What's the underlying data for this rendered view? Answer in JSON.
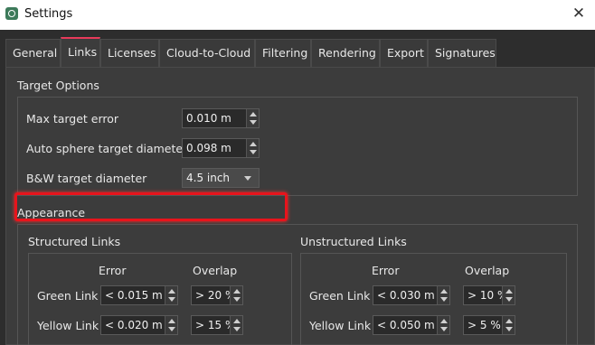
{
  "window": {
    "title": "Settings",
    "close_glyph": "✕",
    "icon": "app-icon"
  },
  "tabs": [
    {
      "label": "General"
    },
    {
      "label": "Links",
      "active": true
    },
    {
      "label": "Licenses"
    },
    {
      "label": "Cloud-to-Cloud"
    },
    {
      "label": "Filtering"
    },
    {
      "label": "Rendering"
    },
    {
      "label": "Export"
    },
    {
      "label": "Signatures"
    }
  ],
  "target_options": {
    "title": "Target Options",
    "max_target_error": {
      "label": "Max target error",
      "value": "0.010 m"
    },
    "auto_sphere": {
      "label": "Auto sphere target diameter",
      "value": "0.098 m"
    },
    "bw_target": {
      "label": "B&W target diameter",
      "value": "4.5 inch"
    }
  },
  "appearance": {
    "title": "Appearance",
    "structured": {
      "title": "Structured Links",
      "col_error": "Error",
      "col_overlap": "Overlap",
      "green": {
        "label": "Green Link",
        "error": "< 0.015 m",
        "overlap": "> 20 %"
      },
      "yellow": {
        "label": "Yellow Link",
        "error": "< 0.020 m",
        "overlap": "> 15 %"
      }
    },
    "unstructured": {
      "title": "Unstructured Links",
      "col_error": "Error",
      "col_overlap": "Overlap",
      "green": {
        "label": "Green Link",
        "error": "< 0.030 m",
        "overlap": "> 10 %"
      },
      "yellow": {
        "label": "Yellow Link",
        "error": "< 0.050 m",
        "overlap": "> 5 %"
      }
    }
  },
  "colors": {
    "accent_tab": "#e83a5a",
    "highlight": "#e8141c"
  }
}
